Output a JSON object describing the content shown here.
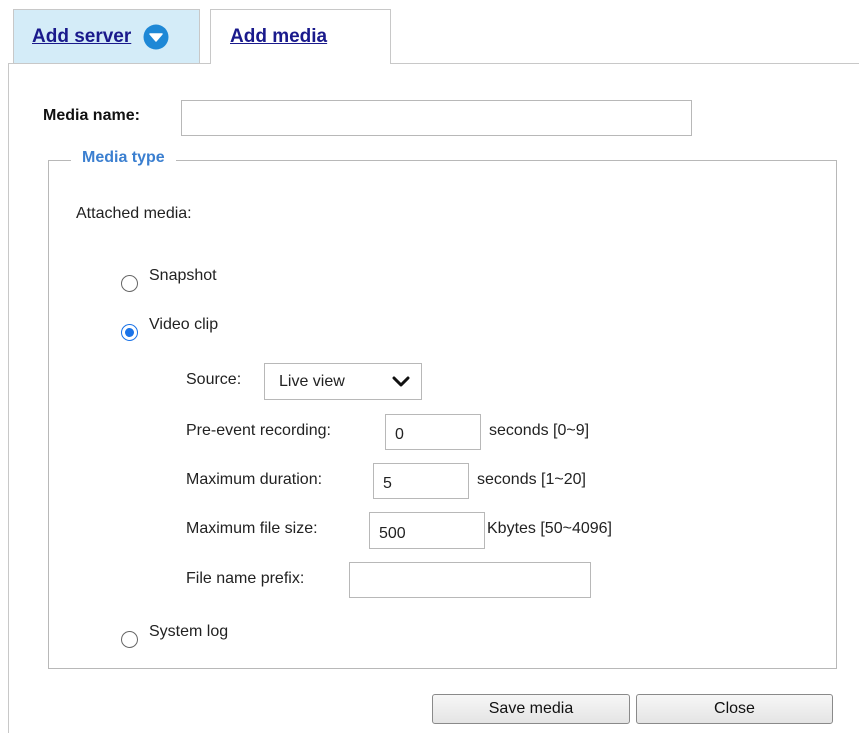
{
  "tabs": {
    "add_server": "Add server",
    "add_media": "Add media"
  },
  "media_name": {
    "label": "Media name:",
    "value": ""
  },
  "media_type": {
    "legend": "Media type",
    "attached_label": "Attached media:",
    "options": {
      "snapshot": "Snapshot",
      "video_clip": "Video clip",
      "system_log": "System log"
    },
    "selected": "Video clip"
  },
  "video_clip": {
    "source_label": "Source:",
    "source_value": "Live view",
    "pre_event_label": "Pre-event recording:",
    "pre_event_value": "0",
    "pre_event_unit": "seconds [0~9]",
    "max_duration_label": "Maximum duration:",
    "max_duration_value": "5",
    "max_duration_unit": "seconds [1~20]",
    "max_file_size_label": "Maximum file size:",
    "max_file_size_value": "500",
    "max_file_size_unit": "Kbytes [50~4096]",
    "file_prefix_label": "File name prefix:",
    "file_prefix_value": ""
  },
  "buttons": {
    "save": "Save media",
    "close": "Close"
  },
  "colors": {
    "server_tab_bg": "#d4ecf8",
    "accent_blue": "#3b7fd0",
    "radio_checked": "#1a73e8",
    "link": "#1a1a8c"
  },
  "icons": {
    "server_tab_icon": "chevron-down-circle-icon",
    "select_icon": "chevron-down-icon"
  }
}
